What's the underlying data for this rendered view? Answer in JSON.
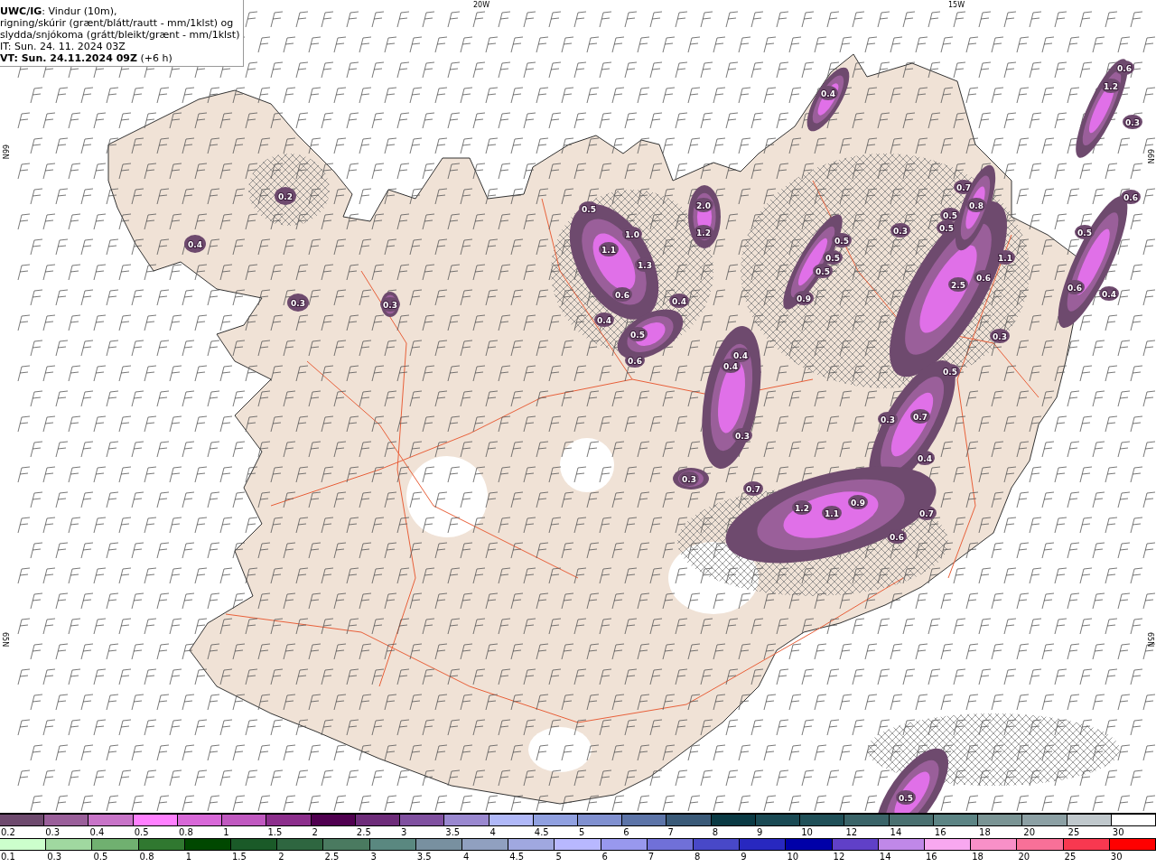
{
  "header": {
    "lines": [
      "**UWC/IG**: Vindur (10m),",
      "rigning/skúrir (grænt/blátt/rautt - mm/1klst) og",
      "slydda/snjókoma (grátt/bleikt/grænt - mm/1klst)",
      "IT: Sun. 24. 11. 2024 03Z",
      "**VT: Sun. 24.11.2024 09Z** (+6 h)"
    ]
  },
  "map": {
    "axis_labels": [
      "20W",
      "15W",
      "66N",
      "65N",
      "66N",
      "65N"
    ],
    "values": [
      "0.4",
      "0.2",
      "0.4",
      "0.3",
      "0.3",
      "0.5",
      "1.1",
      "1.0",
      "1.3",
      "0.6",
      "0.4",
      "0.5",
      "0.6",
      "2.0",
      "1.2",
      "0.4",
      "0.4",
      "0.4",
      "0.3",
      "0.3",
      "0.3",
      "0.5",
      "0.5",
      "0.8",
      "0.7",
      "0.5",
      "0.5",
      "0.5",
      "0.9",
      "2.5",
      "0.6",
      "1.1",
      "0.3",
      "0.5",
      "0.7",
      "0.3",
      "0.4",
      "0.7",
      "1.2",
      "1.1",
      "0.9",
      "0.7",
      "0.6",
      "0.6",
      "1.2",
      "0.3",
      "0.6",
      "0.5",
      "0.6",
      "0.4",
      "0.5"
    ]
  },
  "legend": {
    "rows": [
      {
        "items": [
          {
            "label": "0.2",
            "color": "#6e4a6e"
          },
          {
            "label": "0.3",
            "color": "#9a5f9a"
          },
          {
            "label": "0.4",
            "color": "#c874c8"
          },
          {
            "label": "0.5",
            "color": "#ff80ff"
          },
          {
            "label": "0.8",
            "color": "#d868d8"
          },
          {
            "label": "1",
            "color": "#c058c0"
          },
          {
            "label": "1.5",
            "color": "#8c2e8c"
          },
          {
            "label": "2",
            "color": "#500050"
          },
          {
            "label": "2.5",
            "color": "#6e2c7a"
          },
          {
            "label": "3",
            "color": "#8050a0"
          },
          {
            "label": "3.5",
            "color": "#9a88d0"
          },
          {
            "label": "4",
            "color": "#b0b8f8"
          },
          {
            "label": "4.5",
            "color": "#90a0e0"
          },
          {
            "label": "5",
            "color": "#8090d0"
          },
          {
            "label": "6",
            "color": "#5c74a8"
          },
          {
            "label": "7",
            "color": "#3a5a78"
          },
          {
            "label": "8",
            "color": "#0a3a44"
          },
          {
            "label": "9",
            "color": "#1a4a54"
          },
          {
            "label": "10",
            "color": "#205058"
          },
          {
            "label": "12",
            "color": "#3a6468"
          },
          {
            "label": "14",
            "color": "#4a7070"
          },
          {
            "label": "16",
            "color": "#5c8484"
          },
          {
            "label": "18",
            "color": "#7a9494"
          },
          {
            "label": "20",
            "color": "#8ca0a4"
          },
          {
            "label": "25",
            "color": "#c0c8cc"
          },
          {
            "label": "30",
            "color": "#ffffff"
          }
        ]
      },
      {
        "items": [
          {
            "label": "0.1",
            "color": "#ccffcc"
          },
          {
            "label": "0.3",
            "color": "#a0d8a0"
          },
          {
            "label": "0.5",
            "color": "#70b070"
          },
          {
            "label": "0.8",
            "color": "#307830"
          },
          {
            "label": "1",
            "color": "#004800"
          },
          {
            "label": "1.5",
            "color": "#1a5a28"
          },
          {
            "label": "2",
            "color": "#2e6640"
          },
          {
            "label": "2.5",
            "color": "#4a7a60"
          },
          {
            "label": "3",
            "color": "#5a8880"
          },
          {
            "label": "3.5",
            "color": "#7890a0"
          },
          {
            "label": "4",
            "color": "#90a0c0"
          },
          {
            "label": "4.5",
            "color": "#a0a8e0"
          },
          {
            "label": "5",
            "color": "#b8b8ff"
          },
          {
            "label": "6",
            "color": "#9898ee"
          },
          {
            "label": "7",
            "color": "#7070d8"
          },
          {
            "label": "8",
            "color": "#4848c8"
          },
          {
            "label": "9",
            "color": "#2828c0"
          },
          {
            "label": "10",
            "color": "#0000a8"
          },
          {
            "label": "12",
            "color": "#6040c8"
          },
          {
            "label": "14",
            "color": "#c088e8"
          },
          {
            "label": "16",
            "color": "#f8a8f0"
          },
          {
            "label": "18",
            "color": "#f890c8"
          },
          {
            "label": "20",
            "color": "#f87098"
          },
          {
            "label": "25",
            "color": "#f83850"
          },
          {
            "label": "30",
            "color": "#ff0000"
          }
        ]
      }
    ]
  }
}
